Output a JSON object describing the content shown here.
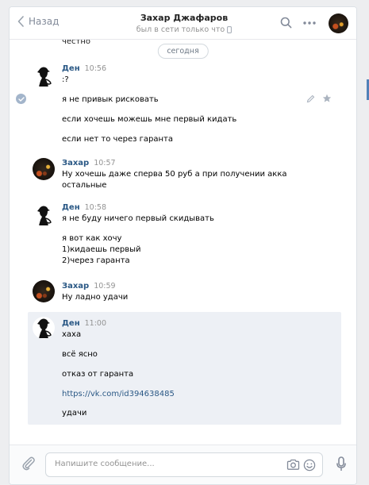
{
  "header": {
    "back_label": "Назад",
    "title": "Захар Джафаров",
    "subtitle": "был в сети только что"
  },
  "history": {
    "cut_text": "честно",
    "date_pill": "сегодня",
    "groups": [
      {
        "author": "Ден",
        "time": "10:56",
        "avatar": "sherlock",
        "lines": [
          ":?",
          "я не привык рисковать",
          "если хочешь можешь мне первый кидать",
          "если нет то через гаранта"
        ]
      },
      {
        "author": "Захар",
        "time": "10:57",
        "avatar": "night-city",
        "lines": [
          "Ну хочешь даже сперва 50 руб а при получении акка",
          "остальные"
        ]
      },
      {
        "author": "Ден",
        "time": "10:58",
        "avatar": "sherlock",
        "lines": [
          "я не буду ничего первый скидывать",
          "я вот как хочу",
          "1)кидаешь первый",
          "2)через гаранта"
        ]
      },
      {
        "author": "Захар",
        "time": "10:59",
        "avatar": "night-city",
        "lines": [
          "Ну ладно удачи"
        ]
      },
      {
        "author": "Ден",
        "time": "11:00",
        "avatar": "sherlock",
        "lines": [
          "хаха",
          "всё ясно",
          "отказ от гаранта",
          "https://vk.com/id394638485",
          "удачи"
        ]
      }
    ]
  },
  "composer": {
    "placeholder": "Напишите сообщение..."
  },
  "colors": {
    "link": "#2a5885",
    "muted": "#939393",
    "selected_bg": "#edf0f5",
    "accent": "#5181b8"
  }
}
